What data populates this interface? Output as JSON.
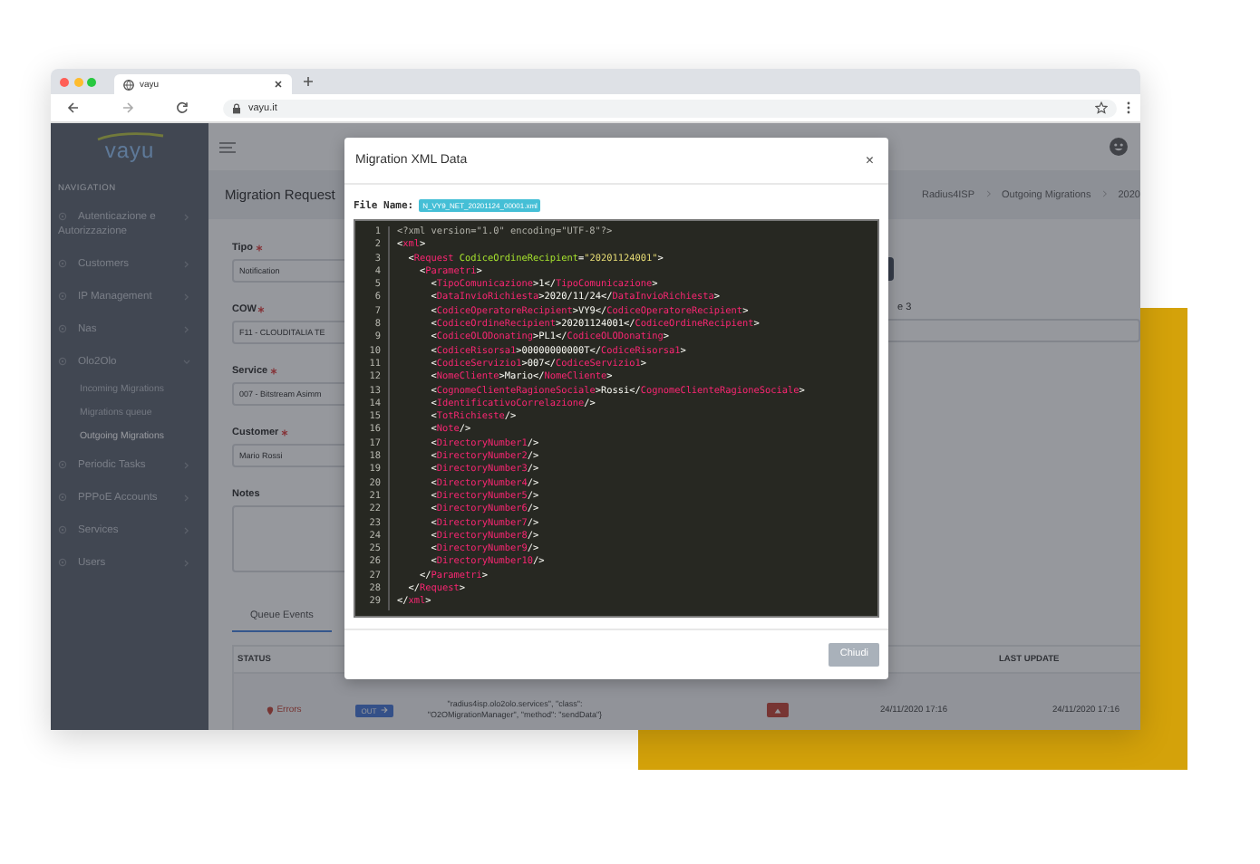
{
  "browser": {
    "tab_title": "vayu",
    "url": "vayu.it"
  },
  "sidebar": {
    "logo": "vayu",
    "section": "NAVIGATION",
    "items": [
      {
        "label": "Autenticazione e Autorizzazione",
        "expanded": false
      },
      {
        "label": "Customers",
        "expanded": false
      },
      {
        "label": "IP Management",
        "expanded": false
      },
      {
        "label": "Nas",
        "expanded": false
      },
      {
        "label": "Olo2Olo",
        "expanded": true,
        "children": [
          {
            "label": "Incoming Migrations",
            "selected": false
          },
          {
            "label": "Migrations queue",
            "selected": false
          },
          {
            "label": "Outgoing Migrations",
            "selected": true
          }
        ]
      },
      {
        "label": "Periodic Tasks",
        "expanded": false
      },
      {
        "label": "PPPoE Accounts",
        "expanded": false
      },
      {
        "label": "Services",
        "expanded": false
      },
      {
        "label": "Users",
        "expanded": false
      }
    ]
  },
  "page": {
    "title": "Migration Request",
    "breadcrumb": [
      "Radius4ISP",
      "Outgoing Migrations",
      "2020"
    ]
  },
  "form": {
    "fields": [
      {
        "kind": "select",
        "label": "Tipo",
        "required": true,
        "value": "Notification"
      },
      {
        "kind": "select",
        "label": "COW",
        "required": true,
        "value": "F11 - CLOUDITALIA TE"
      },
      {
        "kind": "select",
        "label": "Service",
        "required": true,
        "value": "007 - Bitstream Asimm"
      },
      {
        "kind": "select",
        "label": "Customer",
        "required": true,
        "value": "Mario Rossi"
      },
      {
        "kind": "textarea",
        "label": "Notes",
        "required": false
      }
    ],
    "side_label": "e 3"
  },
  "tabs": [
    {
      "label": "Queue Events",
      "selected": true
    }
  ],
  "table": {
    "status_header": "STATUS",
    "last_update_header": "LAST UPDATE",
    "rows": [
      {
        "status": "Errors",
        "direction": "OUT",
        "detail": "\"radius4isp.olo2olo.services\", \"class\": \"O2OMigrationManager\", \"method\": \"sendData\"}",
        "created": "24/11/2020 17:16",
        "last_update": "24/11/2020 17:16"
      }
    ]
  },
  "modal": {
    "title": "Migration XML Data",
    "close": "×",
    "file_label": "File Name:",
    "file_name": "N_VY9_NET_20201124_00001.xml",
    "button": "Chiudi",
    "code_lines": [
      {
        "number": "1",
        "text": "<?xml version=\"1.0\" encoding=\"UTF-8\"?>"
      },
      {
        "number": "2",
        "text": "<xml>"
      },
      {
        "number": "3",
        "text": "  <Request CodiceOrdineRecipient=\"20201124001\">"
      },
      {
        "number": "4",
        "text": "    <Parametri>"
      },
      {
        "number": "5",
        "text": "      <TipoComunicazione>1</TipoComunicazione>"
      },
      {
        "number": "6",
        "text": "      <DataInvioRichiesta>2020/11/24</DataInvioRichiesta>"
      },
      {
        "number": "7",
        "text": "      <CodiceOperatoreRecipient>VY9</CodiceOperatoreRecipient>"
      },
      {
        "number": "8",
        "text": "      <CodiceOrdineRecipient>20201124001</CodiceOrdineRecipient>"
      },
      {
        "number": "9",
        "text": "      <CodiceOLODonating>PL1</CodiceOLODonating>"
      },
      {
        "number": "10",
        "text": "      <CodiceRisorsa1>00000000000T</CodiceRisorsa1>"
      },
      {
        "number": "11",
        "text": "      <CodiceServizio1>007</CodiceServizio1>"
      },
      {
        "number": "12",
        "text": "      <NomeCliente>Mario</NomeCliente>"
      },
      {
        "number": "13",
        "text": "      <CognomeClienteRagioneSociale>Rossi</CognomeClienteRagioneSociale>"
      },
      {
        "number": "14",
        "text": "      <IdentificativoCorrelazione/>"
      },
      {
        "number": "15",
        "text": "      <TotRichieste/>"
      },
      {
        "number": "16",
        "text": "      <Note/>"
      },
      {
        "number": "17",
        "text": "      <DirectoryNumber1/>"
      },
      {
        "number": "18",
        "text": "      <DirectoryNumber2/>"
      },
      {
        "number": "19",
        "text": "      <DirectoryNumber3/>"
      },
      {
        "number": "20",
        "text": "      <DirectoryNumber4/>"
      },
      {
        "number": "21",
        "text": "      <DirectoryNumber5/>"
      },
      {
        "number": "22",
        "text": "      <DirectoryNumber6/>"
      },
      {
        "number": "23",
        "text": "      <DirectoryNumber7/>"
      },
      {
        "number": "24",
        "text": "      <DirectoryNumber8/>"
      },
      {
        "number": "25",
        "text": "      <DirectoryNumber9/>"
      },
      {
        "number": "26",
        "text": "      <DirectoryNumber10/>"
      },
      {
        "number": "27",
        "text": "    </Parametri>"
      },
      {
        "number": "28",
        "text": "  </Request>"
      },
      {
        "number": "29",
        "text": "</xml>"
      }
    ]
  }
}
